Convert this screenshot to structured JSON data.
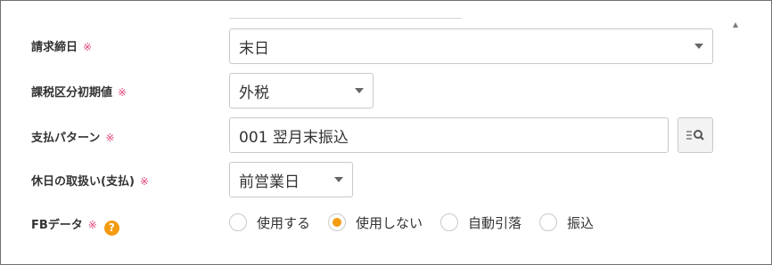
{
  "form": {
    "required_mark": "※",
    "closing_day": {
      "label": "請求締日",
      "value": "末日"
    },
    "tax_category_default": {
      "label": "課税区分初期値",
      "value": "外税"
    },
    "payment_pattern": {
      "label": "支払パターン",
      "value": "001 翌月末振込",
      "lookup_icon": "list-search-icon"
    },
    "holiday_handling": {
      "label": "休日の取扱い(支払)",
      "value": "前営業日"
    },
    "fb_data": {
      "label": "FBデータ",
      "help_icon": "?",
      "options": [
        {
          "label": "使用する",
          "checked": false
        },
        {
          "label": "使用しない",
          "checked": true
        },
        {
          "label": "自動引落",
          "checked": false
        },
        {
          "label": "振込",
          "checked": false
        }
      ]
    }
  },
  "colors": {
    "required": "#e2467a",
    "accent": "#f39c12",
    "border": "#c9c9c9"
  }
}
